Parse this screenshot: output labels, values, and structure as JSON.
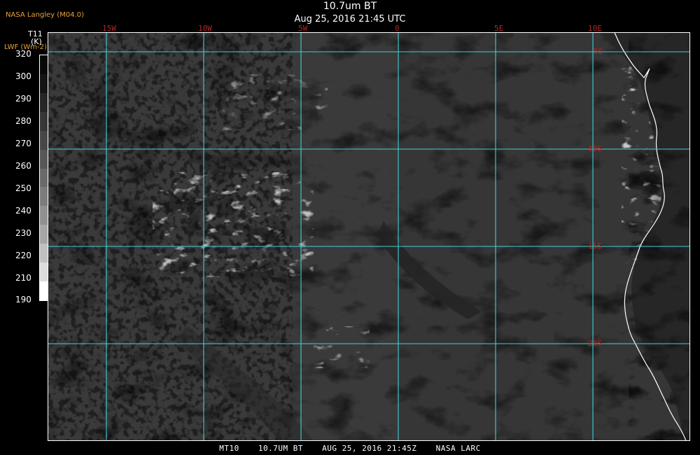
{
  "header": {
    "agency": "NASA Langley (M04.0)",
    "title": "10.7um BT",
    "subtitle": "Aug 25, 2016 21:45 UTC"
  },
  "colorbar": {
    "label_line1": "T11",
    "label_line2": "(K)",
    "label_line3": "LWF (Wm-2)",
    "ticks": [
      "320",
      "300",
      "290",
      "280",
      "270",
      "260",
      "250",
      "240",
      "230",
      "220",
      "210",
      "190"
    ],
    "colors": [
      "#080808",
      "#141414",
      "#262626",
      "#363636",
      "#474747",
      "#585858",
      "#6a6a6a",
      "#7c7c7c",
      "#909090",
      "#a6a6a6",
      "#c0c0c0",
      "#dcdcdc",
      "#ffffff"
    ]
  },
  "map": {
    "lon_labels": [
      "15W",
      "10W",
      "5W",
      "0",
      "5E",
      "10E"
    ],
    "lat_labels": [
      "5S",
      "10S",
      "15S",
      "20S"
    ],
    "grid_color": "#40d0d8",
    "coast_color": "#ffffff"
  },
  "footer": {
    "sat": "MT10",
    "channel": "10.7UM BT",
    "date": "AUG 25, 2016 21:45Z",
    "source": "NASA LARC"
  }
}
